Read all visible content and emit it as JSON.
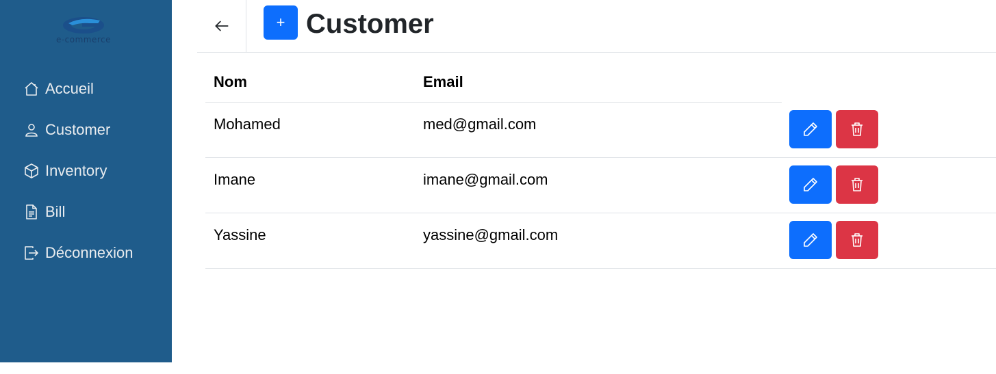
{
  "sidebar": {
    "logo_text": "e-commerce",
    "items": [
      {
        "label": "Accueil",
        "icon": "home-icon"
      },
      {
        "label": "Customer",
        "icon": "person-icon"
      },
      {
        "label": "Inventory",
        "icon": "box-icon"
      },
      {
        "label": "Bill",
        "icon": "document-icon"
      },
      {
        "label": "Déconnexion",
        "icon": "logout-icon"
      }
    ]
  },
  "header": {
    "back_icon": "arrow-left-icon",
    "add_label": "+",
    "title": "Customer"
  },
  "table": {
    "columns": [
      "Nom",
      "Email"
    ],
    "rows": [
      {
        "nom": "Mohamed",
        "email": "med@gmail.com"
      },
      {
        "nom": "Imane",
        "email": "imane@gmail.com"
      },
      {
        "nom": "Yassine",
        "email": "yassine@gmail.com"
      }
    ],
    "edit_icon": "pencil-icon",
    "delete_icon": "trash-icon"
  },
  "colors": {
    "sidebar_bg": "#1f5c8b",
    "primary": "#0d6efd",
    "danger": "#dc3545"
  }
}
